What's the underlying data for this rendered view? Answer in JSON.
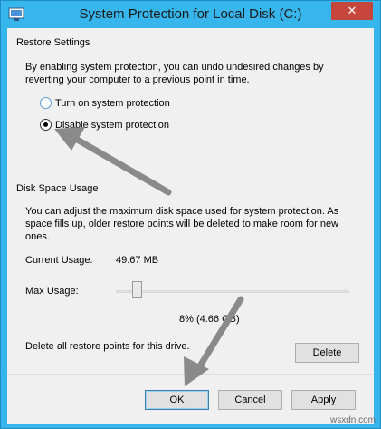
{
  "window": {
    "title": "System Protection for Local Disk (C:)",
    "close_label": "✕",
    "accent": "#36b6ec"
  },
  "restore_settings": {
    "heading": "Restore Settings",
    "description_line1": "By enabling system protection, you can undo undesired changes by",
    "description_line2": "reverting your computer to a previous point in time.",
    "options": [
      {
        "label": "Turn on system protection",
        "selected": false
      },
      {
        "label": "Disable system protection",
        "selected": true
      }
    ]
  },
  "disk_space": {
    "heading": "Disk Space Usage",
    "description_line1": "You can adjust the maximum disk space used for system protection. As",
    "description_line2": "space fills up, older restore points will be deleted to make room for new",
    "description_line3": "ones.",
    "current_usage_label": "Current Usage:",
    "current_usage_value": "49.67 MB",
    "max_usage_label": "Max Usage:",
    "max_usage_value": "8% (4.66 GB)",
    "max_usage_fraction": 0.08,
    "delete_text": "Delete all restore points for this drive.",
    "delete_button": "Delete"
  },
  "buttons": {
    "ok": "OK",
    "cancel": "Cancel",
    "apply": "Apply"
  },
  "annotation_color": "#8a8a8a",
  "watermark": "wsxdn.com"
}
